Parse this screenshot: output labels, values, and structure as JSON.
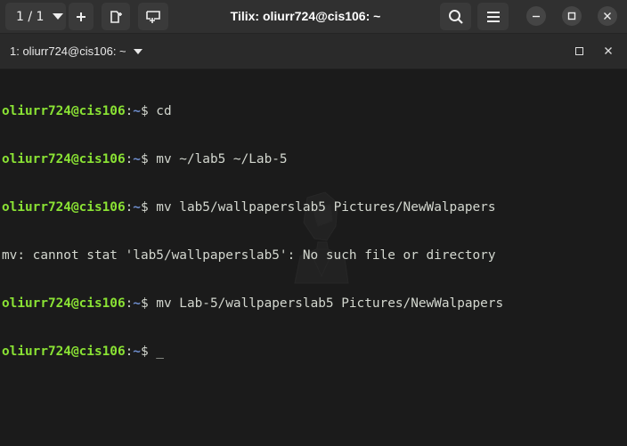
{
  "header": {
    "session_indicator": "1 / 1",
    "title": "Tilix: oliurr724@cis106: ~",
    "icons": {
      "session_dropdown": "caret-down-icon",
      "add_session": "plus-icon",
      "add_right": "split-right-icon",
      "add_down": "split-down-icon",
      "search": "search-icon",
      "menu": "hamburger-menu-icon",
      "minimize": "minimize-icon",
      "maximize": "maximize-icon",
      "close": "close-icon"
    }
  },
  "terminal": {
    "title": "1: oliurr724@cis106: ~",
    "maximize_icon": "maximize-icon",
    "close_icon": "close-icon",
    "lines": [
      {
        "type": "prompt",
        "user": "oliurr724@cis106",
        "sep": ":",
        "path": "~",
        "symbol": "$ ",
        "command": "cd"
      },
      {
        "type": "prompt",
        "user": "oliurr724@cis106",
        "sep": ":",
        "path": "~",
        "symbol": "$ ",
        "command": "mv ~/lab5 ~/Lab-5"
      },
      {
        "type": "prompt",
        "user": "oliurr724@cis106",
        "sep": ":",
        "path": "~",
        "symbol": "$ ",
        "command": "mv lab5/wallpaperslab5 Pictures/NewWalpapers"
      },
      {
        "type": "output",
        "text": "mv: cannot stat 'lab5/wallpaperslab5': No such file or directory"
      },
      {
        "type": "prompt",
        "user": "oliurr724@cis106",
        "sep": ":",
        "path": "~",
        "symbol": "$ ",
        "command": "mv Lab-5/wallpaperslab5 Pictures/NewWalpapers"
      },
      {
        "type": "prompt",
        "user": "oliurr724@cis106",
        "sep": ":",
        "path": "~",
        "symbol": "$ ",
        "command": "_"
      }
    ],
    "colors": {
      "background": "#1b1b1b",
      "user": "#8ae234",
      "path": "#6f8fcf",
      "text": "#d3d7cf",
      "headerbar": "#303030"
    },
    "watermark_icon": "tilix-watermark-icon"
  }
}
